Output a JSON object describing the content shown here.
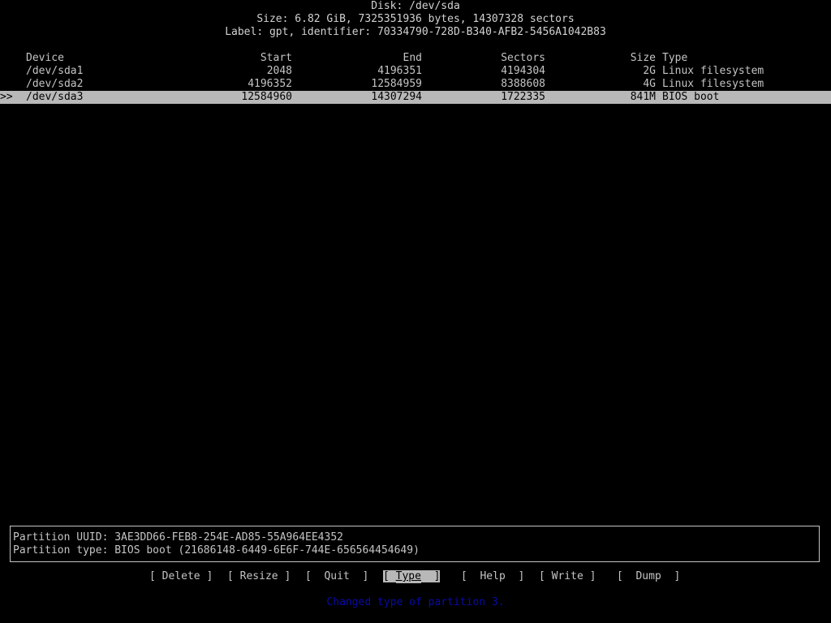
{
  "header": {
    "disk_line": "Disk: /dev/sda",
    "size_line": "Size: 6.82 GiB, 7325351936 bytes, 14307328 sectors",
    "label_line": "Label: gpt, identifier: 70334790-728D-B340-AFB2-5456A1042B83"
  },
  "table": {
    "columns": {
      "device": "Device",
      "start": "Start",
      "end": "End",
      "sectors": "Sectors",
      "size": "Size",
      "type": "Type"
    },
    "selection_marker": ">>",
    "rows": [
      {
        "device": "/dev/sda1",
        "start": "2048",
        "end": "4196351",
        "sectors": "4194304",
        "size": "2G",
        "type": "Linux filesystem",
        "selected": false
      },
      {
        "device": "/dev/sda2",
        "start": "4196352",
        "end": "12584959",
        "sectors": "8388608",
        "size": "4G",
        "type": "Linux filesystem",
        "selected": false
      },
      {
        "device": "/dev/sda3",
        "start": "12584960",
        "end": "14307294",
        "sectors": "1722335",
        "size": "841M",
        "type": "BIOS boot",
        "selected": true
      }
    ]
  },
  "info": {
    "uuid_line": "Partition UUID: 3AE3DD66-FEB8-254E-AD85-55A964EE4352",
    "type_line": "Partition type: BIOS boot (21686148-6449-6E6F-744E-656564454649)"
  },
  "menu": {
    "items": [
      {
        "label": "Delete",
        "active": false
      },
      {
        "label": "Resize",
        "active": false
      },
      {
        "label": "Quit",
        "active": false
      },
      {
        "label": "Type",
        "active": true
      },
      {
        "label": "Help",
        "active": false
      },
      {
        "label": "Write",
        "active": false
      },
      {
        "label": "Dump",
        "active": false
      }
    ]
  },
  "status": {
    "message": "Changed type of partition 3.",
    "color": "#0a0aa8"
  },
  "colors": {
    "background": "#000000",
    "foreground": "#c4c4c4",
    "highlight": "#b8b8b8"
  }
}
